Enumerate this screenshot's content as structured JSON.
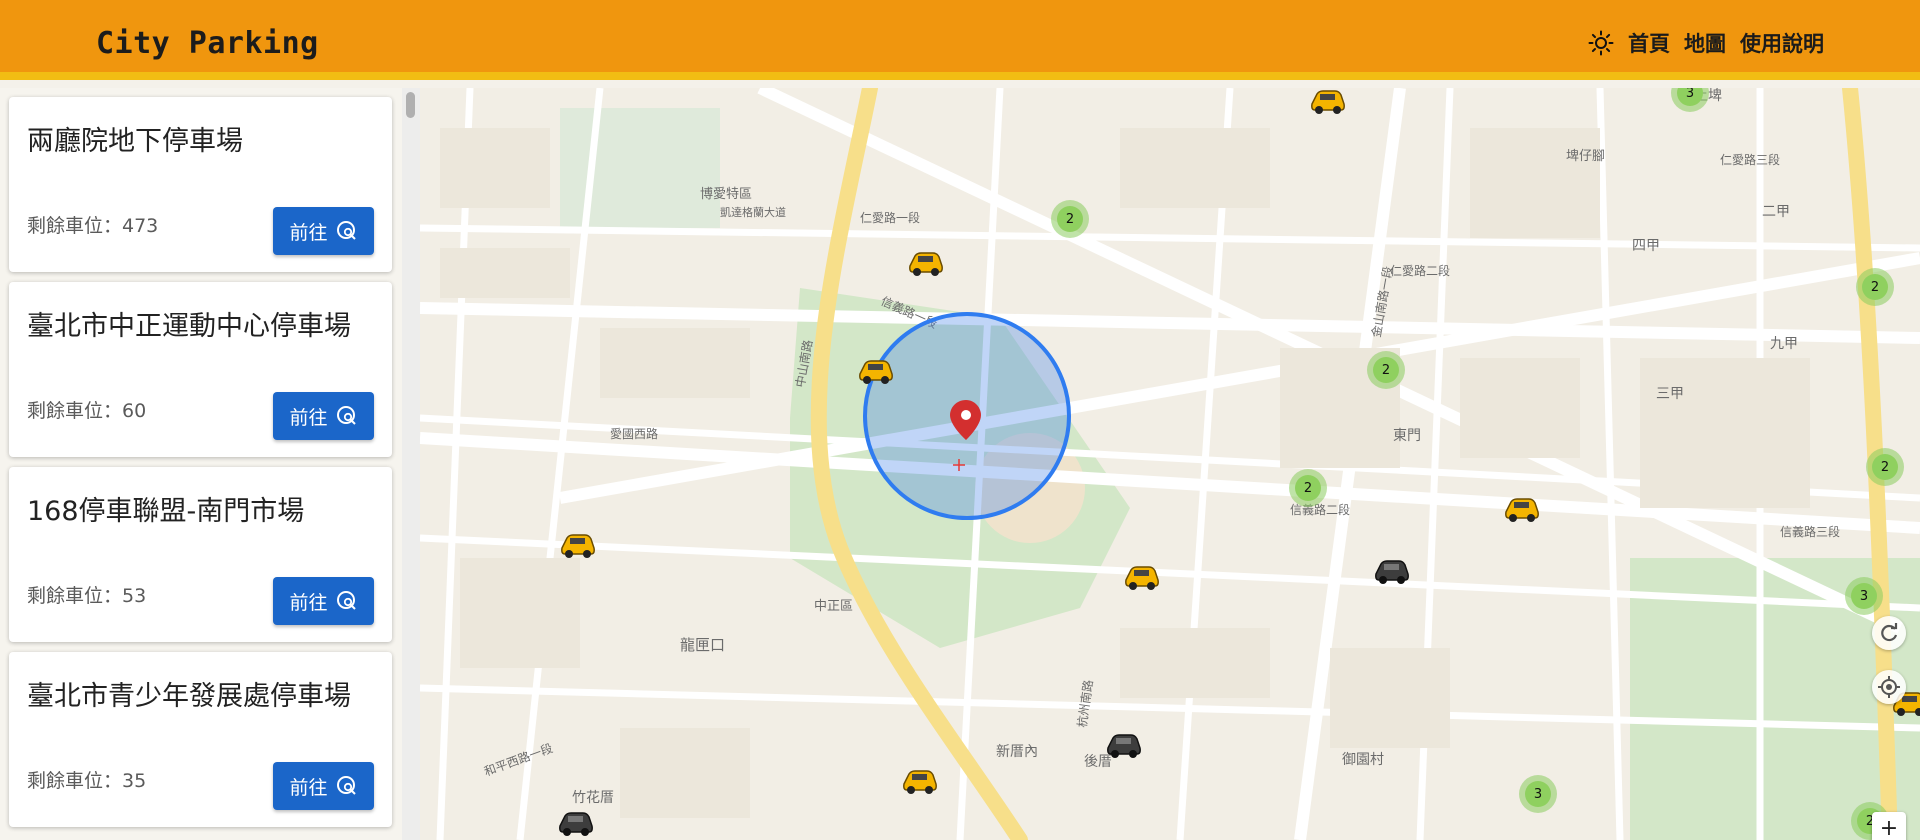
{
  "header": {
    "brand": "City Parking",
    "nav": [
      {
        "label": "首頁"
      },
      {
        "label": "地圖"
      },
      {
        "label": "使用說明"
      }
    ]
  },
  "parking_lots": [
    {
      "name": "兩廳院地下停車場",
      "available": "剩餘車位：473",
      "button": "前往"
    },
    {
      "name": "臺北市中正運動中心停車場",
      "available": "剩餘車位：60",
      "button": "前往"
    },
    {
      "name": "168停車聯盟-南門市場",
      "available": "剩餘車位：53",
      "button": "前往"
    },
    {
      "name": "臺北市青少年發展處停車場",
      "available": "剩餘車位：35",
      "button": "前往"
    }
  ],
  "map": {
    "zoom_in": "+",
    "zoom_out": "−",
    "clusters": [
      "3",
      "2",
      "2",
      "2",
      "2",
      "2",
      "3",
      "3",
      "2"
    ],
    "street_labels": [
      "博愛特區",
      "凱達格蘭大道",
      "仁愛路一段",
      "仁愛路二段",
      "信義路一段",
      "信義路二段",
      "愛國西路",
      "中正區",
      "龍匣口",
      "東門",
      "四甲",
      "二甲",
      "九甲",
      "三甲",
      "新厝內",
      "後厝",
      "御園村",
      "竹花厝",
      "上埤",
      "埤仔腳",
      "中山南路",
      "金山南路一段",
      "杭州南路",
      "仁愛路三段",
      "信義路三段",
      "和平西路一段"
    ],
    "colors": {
      "header": "#f0960e",
      "button": "#1b66c9",
      "cluster": "#8fd05f",
      "radius_circle": "#2f7cf0"
    }
  }
}
